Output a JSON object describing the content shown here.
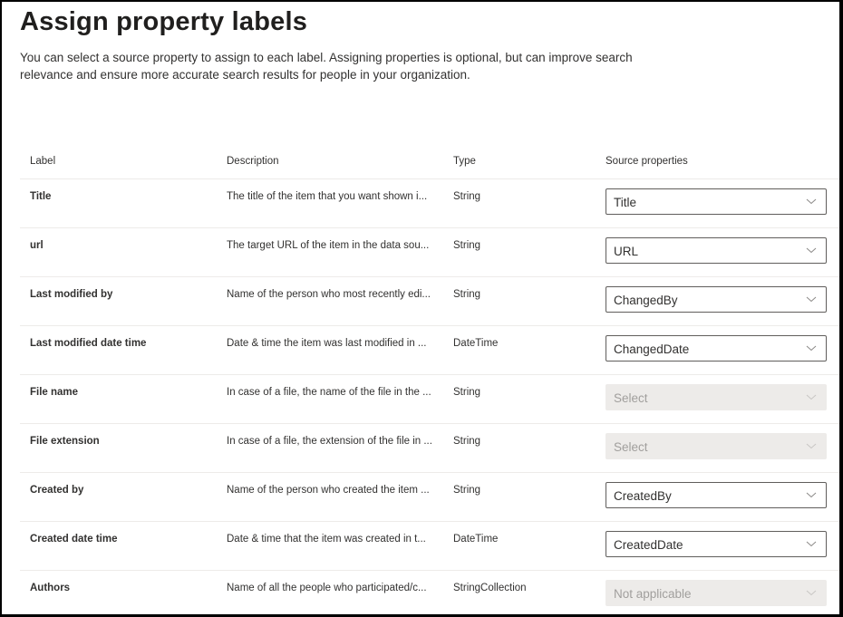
{
  "page": {
    "title": "Assign property labels",
    "description": "You can select a source property to assign to each label. Assigning properties is optional, but can improve search relevance and ensure more accurate search results for people in your organization."
  },
  "table": {
    "headers": {
      "label": "Label",
      "description": "Description",
      "type": "Type",
      "source": "Source properties"
    },
    "rows": [
      {
        "label": "Title",
        "description": "The title of the item that you want shown i...",
        "type": "String",
        "source": "Title",
        "disabled": false
      },
      {
        "label": "url",
        "description": "The target URL of the item in the data sou...",
        "type": "String",
        "source": "URL",
        "disabled": false
      },
      {
        "label": "Last modified by",
        "description": "Name of the person who most recently edi...",
        "type": "String",
        "source": "ChangedBy",
        "disabled": false
      },
      {
        "label": "Last modified date time",
        "description": "Date & time the item was last modified in ...",
        "type": "DateTime",
        "source": "ChangedDate",
        "disabled": false
      },
      {
        "label": "File name",
        "description": "In case of a file, the name of the file in the ...",
        "type": "String",
        "source": "Select",
        "disabled": true
      },
      {
        "label": "File extension",
        "description": "In case of a file, the extension of the file in ...",
        "type": "String",
        "source": "Select",
        "disabled": true
      },
      {
        "label": "Created by",
        "description": "Name of the person who created the item ...",
        "type": "String",
        "source": "CreatedBy",
        "disabled": false
      },
      {
        "label": "Created date time",
        "description": "Date & time that the item was created in t...",
        "type": "DateTime",
        "source": "CreatedDate",
        "disabled": false
      },
      {
        "label": "Authors",
        "description": "Name of all the people who participated/c...",
        "type": "StringCollection",
        "source": "Not applicable",
        "disabled": true
      }
    ]
  },
  "icons": {
    "dropdown": "chevron-down-icon"
  }
}
